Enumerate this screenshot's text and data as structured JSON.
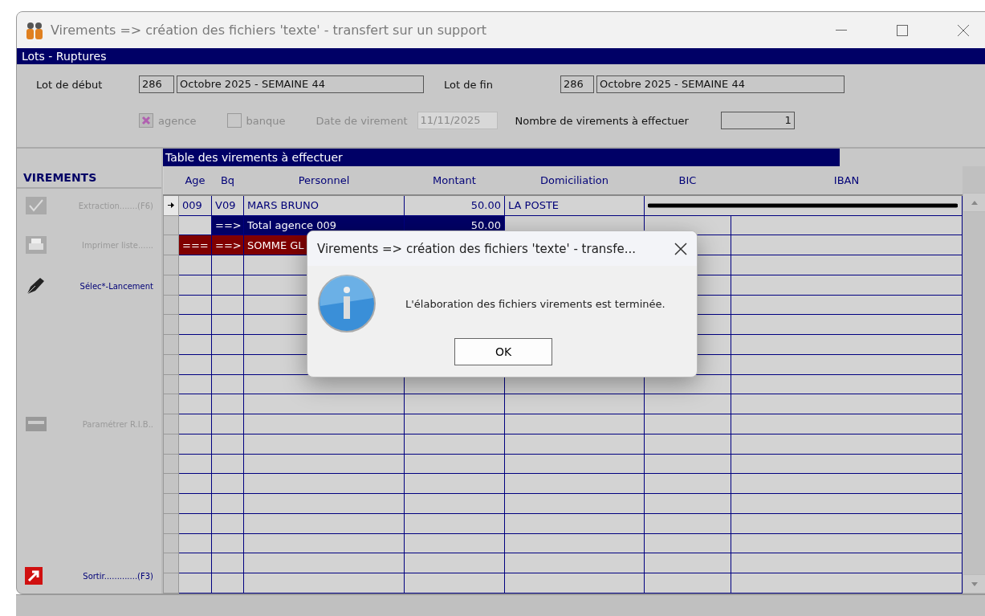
{
  "window": {
    "title": "Virements => création des fichiers 'texte' - transfert sur un support"
  },
  "lots_band": {
    "title": "Lots - Ruptures"
  },
  "form": {
    "start_label": "Lot de début",
    "start_number": "286",
    "start_name": "Octobre 2025 - SEMAINE 44",
    "end_label": "Lot de fin",
    "end_number": "286",
    "end_name": "Octobre 2025 - SEMAINE 44",
    "checkboxes": [
      {
        "label": "agence",
        "checked": true
      },
      {
        "label": "banque",
        "checked": false
      }
    ],
    "date_label": "Date de virement",
    "date_value": "11/11/2025",
    "date_disabled": true,
    "count_label": "Nombre de virements à effectuer",
    "count_value": "1"
  },
  "sidebar": {
    "title": "VIREMENTS",
    "items": [
      {
        "label": "Extraction.......(F6)",
        "disabled": true
      },
      {
        "label": "Imprimer liste......",
        "disabled": true
      },
      {
        "label": "Sélec*-Lancement",
        "disabled": false
      },
      {
        "label": "Paramétrer R.I.B..",
        "disabled": true
      },
      {
        "label": "Sortir.............(F3)",
        "disabled": false
      }
    ]
  },
  "table": {
    "title": "Table des virements à effectuer",
    "columns": [
      "Age",
      "Bq",
      "Personnel",
      "Montant",
      "Domiciliation",
      "BIC",
      "IBAN"
    ],
    "rows": [
      {
        "kind": "data",
        "selected": true,
        "cells": [
          "009",
          "V09",
          "MARS BRUNO",
          "50.00",
          "LA POSTE"
        ],
        "redacted": true
      },
      {
        "kind": "total",
        "selected": false,
        "cells": [
          "",
          "==>",
          "Total agence 009",
          "50.00"
        ]
      },
      {
        "kind": "grand",
        "selected": false,
        "cells": [
          "===",
          "==>",
          "SOMME GL"
        ]
      }
    ]
  },
  "dialog": {
    "title": "Virements => création des fichiers 'texte' - transfe...",
    "message": "L'élaboration des fichiers virements est terminée.",
    "button": "OK"
  }
}
